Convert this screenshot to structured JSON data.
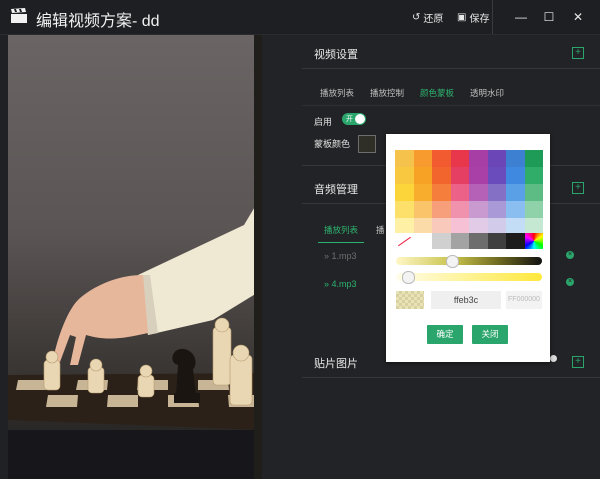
{
  "window": {
    "title": "编辑视频方案- dd",
    "actions": [
      {
        "label": "还原",
        "icon": "undo-icon"
      },
      {
        "label": "保存",
        "icon": "save-icon"
      }
    ],
    "controls": {
      "minimize": "—",
      "maximize": "☐",
      "close": "✕"
    }
  },
  "video_settings": {
    "title": "视频设置",
    "tabs": [
      {
        "label": "播放列表",
        "active": false
      },
      {
        "label": "播放控制",
        "active": false
      },
      {
        "label": "颜色蒙板",
        "active": true
      },
      {
        "label": "透明水印",
        "active": false
      }
    ],
    "enable_label": "启用",
    "toggle_text": "开",
    "mask_color_label": "蒙板颜色"
  },
  "audio": {
    "title": "音频管理",
    "tabs": [
      {
        "label": "播放列表",
        "active": true
      },
      {
        "label": "播",
        "active": false
      }
    ],
    "files": [
      "1.mp3",
      "4.mp3"
    ],
    "file_prefix": "»"
  },
  "sticker": {
    "title": "贴片图片"
  },
  "color_picker": {
    "hex_value": "ffeb3c",
    "alpha_placeholder": "FF000000",
    "confirm_label": "确定",
    "close_label": "关闭",
    "palette": [
      [
        "#f5c24c",
        "#f79b2e",
        "#f25b2f",
        "#e8374a",
        "#a63ea5",
        "#6b46b6",
        "#3d7fd0",
        "#1e9c57"
      ],
      [
        "#f8c940",
        "#f7a224",
        "#f2652c",
        "#e53f64",
        "#a840a8",
        "#6a4cbd",
        "#3f8ae0",
        "#31ad6a"
      ],
      [
        "#fcd53a",
        "#f8ae2c",
        "#f67e3c",
        "#eb6188",
        "#b561b8",
        "#8470c5",
        "#5aa0e6",
        "#5cbc84"
      ],
      [
        "#fde06a",
        "#f9c46a",
        "#f69f7a",
        "#f092ae",
        "#c89ad0",
        "#a999d6",
        "#8abef0",
        "#8fd2a9"
      ],
      [
        "#fef0a4",
        "#fbdca8",
        "#f9c9bc",
        "#f6c1d4",
        "#e1cbe6",
        "#d3cbea",
        "#c4ddf7",
        "#c5e8d2"
      ]
    ],
    "greys": [
      "none",
      "#ffffff",
      "#d0d0d0",
      "#a3a3a3",
      "#6d6d6d",
      "#3f3f3f",
      "#1c1c1c",
      "rainbow"
    ],
    "accent": "#2aa56b"
  }
}
